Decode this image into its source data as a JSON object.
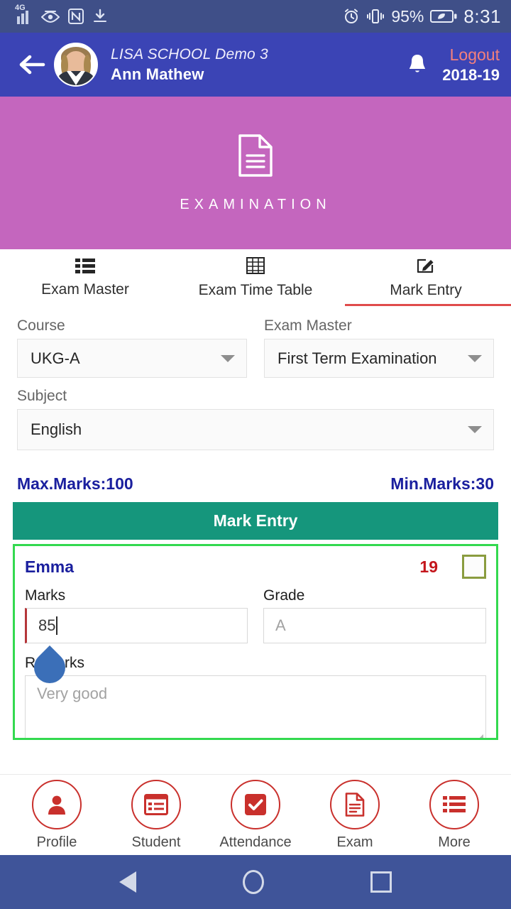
{
  "statusbar": {
    "network": "4G",
    "icons": [
      "signal-icon",
      "eye-icon",
      "nfc-icon",
      "download-icon",
      "alarm-icon",
      "vibrate-icon",
      "battery-saver-icon"
    ],
    "battery_percent": "95%",
    "time": "8:31"
  },
  "header": {
    "back_icon": "back-arrow-icon",
    "avatar": "user-avatar",
    "school_name": "LISA SCHOOL Demo 3",
    "user_name": "Ann Mathew",
    "bell_icon": "notification-bell-icon",
    "logout_label": "Logout",
    "academic_year": "2018-19",
    "bg_color": "#3b44b5",
    "logout_color": "#f4807c"
  },
  "banner": {
    "icon": "document-icon",
    "title": "EXAMINATION",
    "bg_color": "#c466be"
  },
  "tabs": [
    {
      "label": "Exam Master",
      "icon": "list-icon",
      "active": false
    },
    {
      "label": "Exam Time Table",
      "icon": "table-grid-icon",
      "active": false
    },
    {
      "label": "Mark Entry",
      "icon": "edit-pencil-icon",
      "active": true
    }
  ],
  "tab_active_color": "#e04b4b",
  "form": {
    "course": {
      "label": "Course",
      "value": "UKG-A"
    },
    "exam_master": {
      "label": "Exam Master",
      "value": "First Term Examination"
    },
    "subject": {
      "label": "Subject",
      "value": "English"
    }
  },
  "marks_info": {
    "max_marks": "Max.Marks:100",
    "min_marks": "Min.Marks:30",
    "color": "#1a1f9e"
  },
  "section_bar": {
    "title": "Mark Entry",
    "bg_color": "#15967c"
  },
  "student_card": {
    "name": "Emma",
    "score": "19",
    "checkbox_checked": false,
    "border_color": "#33d94f",
    "marks": {
      "label": "Marks",
      "value": "85",
      "focused": true
    },
    "grade": {
      "label": "Grade",
      "placeholder": "A",
      "value": ""
    },
    "remarks": {
      "label": "Remarks",
      "placeholder": "Very good",
      "value": ""
    }
  },
  "bottom_nav": [
    {
      "label": "Profile",
      "icon": "person-icon"
    },
    {
      "label": "Student",
      "icon": "student-list-icon"
    },
    {
      "label": "Attendance",
      "icon": "checkbox-check-icon"
    },
    {
      "label": "Exam",
      "icon": "document-icon"
    },
    {
      "label": "More",
      "icon": "menu-lines-icon"
    }
  ],
  "bottom_nav_color": "#c9302c",
  "android_nav": {
    "back": "android-back-icon",
    "home": "android-home-icon",
    "recents": "android-recents-icon",
    "bg_color": "#3f5499"
  }
}
